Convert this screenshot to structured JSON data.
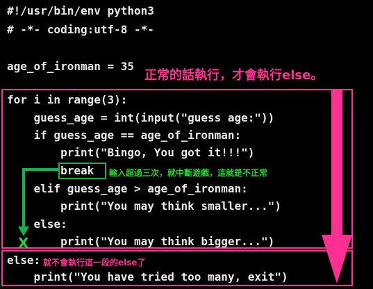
{
  "code": {
    "line1": "#!/usr/bin/env python3",
    "line2": "# -*- coding:utf-8 -*-",
    "line3": "age_of_ironman = 35",
    "line4": "for i in range(3):",
    "line5": "    guess_age = int(input(\"guess age:\"))",
    "line6": "    if guess_age == age_of_ironman:",
    "line7": "        print(\"Bingo, You got it!!!\")",
    "line8": "        break",
    "line9": "    elif guess_age > age_of_ironman:",
    "line10": "        print(\"You may think smaller...\")",
    "line11": "    else:",
    "line12": "        print(\"You may think bigger...\")",
    "line13": "else:",
    "line14": "    print(\"You have tried too many, exit\")"
  },
  "annotations": {
    "normal_exec": "正常的話執行，才會執行else。",
    "break_note": "輸入超過三次，就中斷遊戲，這就是不正常",
    "else_note": "就不會執行這一段的else了",
    "x_mark": "X"
  },
  "colors": {
    "pink": "#ff2f93",
    "green": "#19b24a",
    "text": "#e9e9e9",
    "background": "#000000"
  }
}
